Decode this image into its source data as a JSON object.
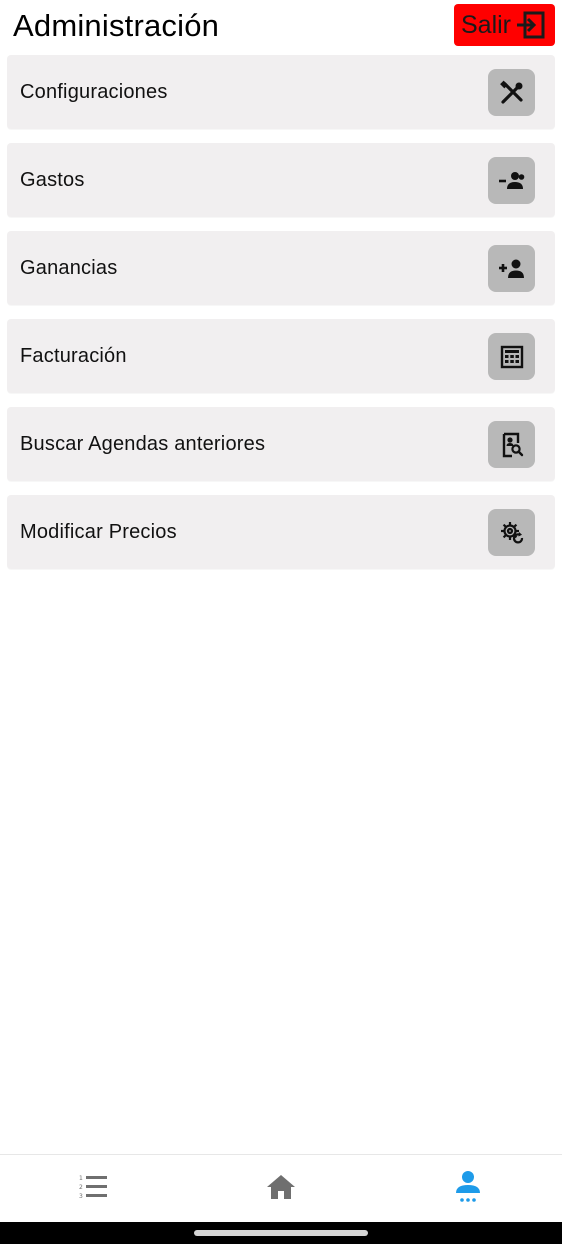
{
  "header": {
    "title": "Administración",
    "logout_label": "Salir",
    "logout_color": "#ff0000"
  },
  "menu": {
    "items": [
      {
        "label": "Configuraciones",
        "icon": "tools-icon"
      },
      {
        "label": "Gastos",
        "icon": "remove-person-icon"
      },
      {
        "label": "Ganancias",
        "icon": "add-person-icon"
      },
      {
        "label": "Facturación",
        "icon": "calculator-icon"
      },
      {
        "label": "Buscar Agendas anteriores",
        "icon": "contact-search-icon"
      },
      {
        "label": "Modificar Precios",
        "icon": "gear-refresh-icon"
      }
    ]
  },
  "bottom_nav": {
    "tabs": [
      {
        "icon": "numbered-list-icon",
        "active": false
      },
      {
        "icon": "home-icon",
        "active": false
      },
      {
        "icon": "account-icon",
        "active": true
      }
    ],
    "active_color": "#1e9be9",
    "inactive_color": "#6f6f6f"
  }
}
